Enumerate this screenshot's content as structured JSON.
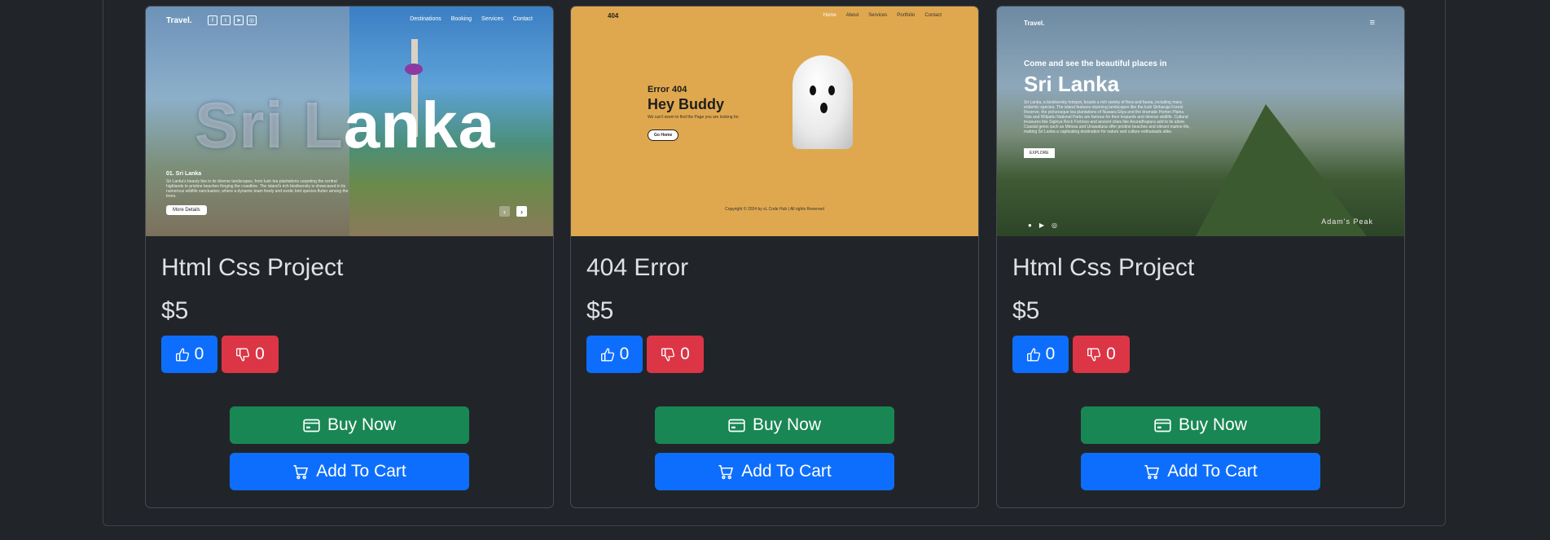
{
  "products": [
    {
      "title": "Html Css Project",
      "price": "$5",
      "likes": "0",
      "dislikes": "0",
      "buy_label": "Buy Now",
      "cart_label": "Add To Cart",
      "preview": {
        "brand": "Travel.",
        "nav": [
          "Destinations",
          "Booking",
          "Services",
          "Contact"
        ],
        "headline_dim": "Sri L",
        "headline_bright": "anka",
        "sub_heading": "01. Sri Lanka",
        "sub_text": "Sri Lanka's beauty lies in its diverse landscapes, from lush tea plantations carpeting the central highlands to pristine beaches fringing the coastline. The island's rich biodiversity is showcased in its numerous wildlife sanctuaries, where a dynamic team freely and exotic bird species flutter among the trees.",
        "button": "More Details"
      }
    },
    {
      "title": "404 Error",
      "price": "$5",
      "likes": "0",
      "dislikes": "0",
      "buy_label": "Buy Now",
      "cart_label": "Add To Cart",
      "preview": {
        "logo": "404",
        "nav": [
          "Home",
          "About",
          "Services",
          "Portfolio",
          "Contact"
        ],
        "error": "Error 404",
        "headline": "Hey Buddy",
        "message": "We can't seem to find the Page you are looking for.",
        "button": "Go Home",
        "copyright": "Copyright © 2024 by sL Code Hub | All rights Reserved"
      }
    },
    {
      "title": "Html Css Project",
      "price": "$5",
      "likes": "0",
      "dislikes": "0",
      "buy_label": "Buy Now",
      "cart_label": "Add To Cart",
      "preview": {
        "brand": "Travel.",
        "intro": "Come and see the beautiful places in",
        "headline": "Sri Lanka",
        "paragraph": "Sri Lanka, a biodiversity hotspot, boasts a rich variety of flora and fauna, including many endemic species. The island features stunning landscapes like the lush Sinharaja Forest Reserve, the picturesque tea plantations of Nuwara Eliya and the dramatic Horton Plains. Yala and Wilpattu National Parks are famous for their leopards and diverse wildlife. Cultural treasures like Sigiriya Rock Fortress and ancient cities like Anuradhapura add to its allure. Coastal gems such as Mirissa and Unawatuna offer pristine beaches and vibrant marine life, making Sri Lanka a captivating destination for nature and culture enthusiasts alike.",
        "button": "EXPLORE",
        "caption": "Adam's Peak"
      }
    }
  ],
  "colors": {
    "like": "#0d6efd",
    "dislike": "#dc3545",
    "buy": "#198754",
    "cart": "#0d6efd",
    "background": "#212529"
  }
}
